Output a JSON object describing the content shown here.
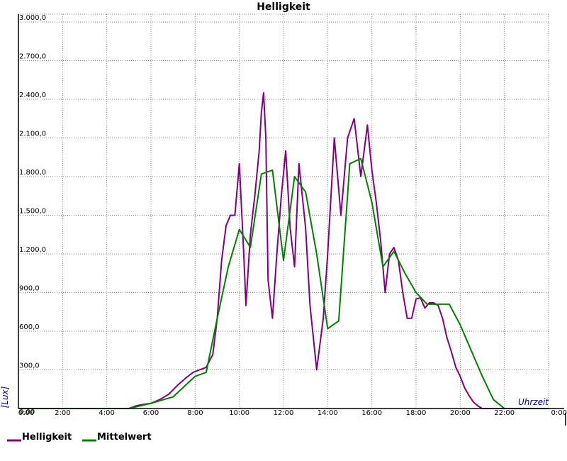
{
  "chart_data": {
    "type": "line",
    "title": "Helligkeit",
    "xlabel": "Uhrzeit",
    "ylabel": "[Lux]",
    "xlim": [
      0,
      24
    ],
    "ylim": [
      0,
      3000
    ],
    "x_ticks": [
      "0:00",
      "2:00",
      "4:00",
      "6:00",
      "8:00",
      "10:00",
      "12:00",
      "14:00",
      "16:00",
      "18:00",
      "20:00",
      "22:00",
      "0:00"
    ],
    "y_ticks": [
      "0,00",
      "300,0",
      "600,0",
      "900,0",
      "1.200,0",
      "1.500,0",
      "1.800,0",
      "2.100,0",
      "2.400,0",
      "2.700,0",
      "3.000,0"
    ],
    "grid": true,
    "legend": "bottom-left",
    "colors": {
      "helligkeit": "#800080",
      "mittelwert": "#008000"
    },
    "series": [
      {
        "name": "Helligkeit",
        "color": "#800080",
        "x": [
          0,
          5.0,
          5.3,
          5.6,
          6.0,
          6.4,
          6.8,
          7.2,
          7.6,
          7.9,
          8.2,
          8.5,
          8.8,
          9.0,
          9.2,
          9.4,
          9.6,
          9.8,
          10.0,
          10.2,
          10.3,
          10.5,
          10.7,
          10.9,
          11.0,
          11.1,
          11.2,
          11.3,
          11.5,
          11.7,
          11.9,
          12.1,
          12.3,
          12.5,
          12.7,
          13.0,
          13.2,
          13.5,
          13.8,
          14.0,
          14.3,
          14.6,
          14.9,
          15.2,
          15.5,
          15.8,
          16.0,
          16.2,
          16.4,
          16.6,
          16.8,
          17.0,
          17.2,
          17.4,
          17.6,
          17.8,
          18.0,
          18.2,
          18.4,
          18.6,
          18.8,
          19.0,
          19.2,
          19.4,
          19.6,
          19.8,
          20.0,
          20.2,
          20.4,
          20.6,
          20.8,
          21.0,
          21.2,
          21.4,
          21.6,
          22.0,
          24
        ],
        "y": [
          0,
          0,
          20,
          30,
          40,
          70,
          110,
          180,
          240,
          280,
          300,
          320,
          420,
          700,
          1150,
          1420,
          1500,
          1500,
          1900,
          1200,
          800,
          1350,
          1650,
          2000,
          2300,
          2450,
          2100,
          1000,
          700,
          1200,
          1650,
          2000,
          1400,
          1100,
          1900,
          1400,
          800,
          300,
          700,
          1200,
          2100,
          1500,
          2100,
          2250,
          1800,
          2200,
          1850,
          1600,
          1300,
          900,
          1200,
          1250,
          1150,
          900,
          700,
          700,
          850,
          860,
          780,
          820,
          820,
          800,
          700,
          550,
          440,
          320,
          250,
          160,
          100,
          50,
          20,
          0,
          0,
          0,
          0,
          0,
          0
        ]
      },
      {
        "name": "Mittelwert",
        "color": "#008000",
        "x": [
          0,
          5.0,
          6.0,
          7.0,
          8.0,
          8.5,
          9.0,
          9.5,
          10.0,
          10.5,
          11.0,
          11.5,
          12.0,
          12.5,
          13.0,
          13.5,
          14.0,
          14.5,
          15.0,
          15.5,
          16.0,
          16.5,
          17.0,
          17.5,
          18.0,
          18.5,
          19.0,
          19.5,
          20.0,
          20.5,
          21.0,
          21.5,
          22.0,
          24
        ],
        "y": [
          0,
          0,
          40,
          90,
          250,
          280,
          700,
          1100,
          1390,
          1250,
          1820,
          1850,
          1150,
          1800,
          1680,
          1200,
          620,
          680,
          1900,
          1940,
          1600,
          1100,
          1220,
          1050,
          900,
          810,
          810,
          810,
          650,
          450,
          250,
          70,
          0,
          0
        ]
      }
    ]
  }
}
